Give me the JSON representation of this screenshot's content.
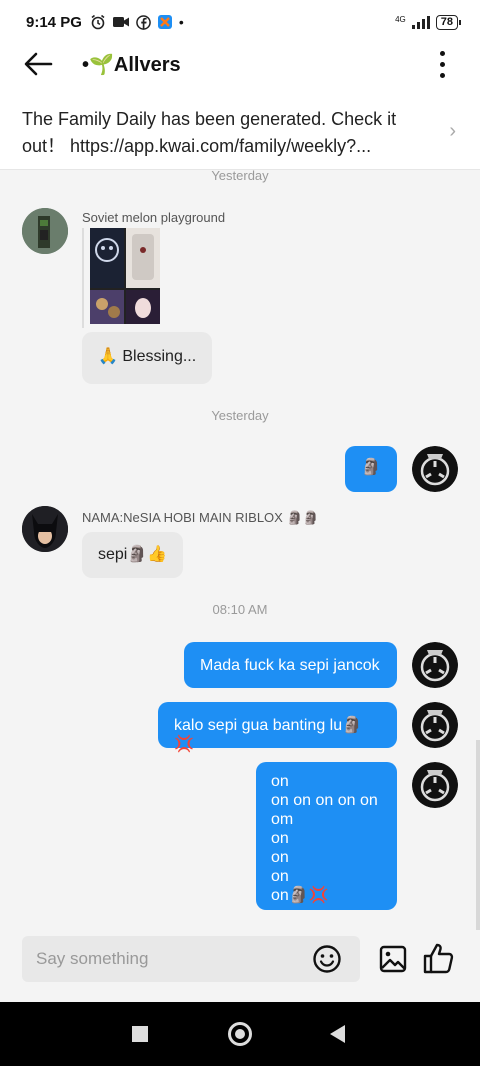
{
  "status_bar": {
    "time": "9:14 PG",
    "network": "4G",
    "battery": "78"
  },
  "header": {
    "title": "•🌱Allvers"
  },
  "notice": {
    "text": "The Family Daily has been generated. Check it out！ https://app.kwai.com/family/weekly?..."
  },
  "chat": {
    "top_timestamp": "Yesterday",
    "msg1": {
      "sender": "Soviet melon playground",
      "text": "🙏 Blessing..."
    },
    "timestamp2": "Yesterday",
    "msg2": {
      "text": "🗿"
    },
    "msg3": {
      "sender": "NAMA:NeSIA HOBI MAIN RIBLOX 🗿🗿",
      "text": "sepi🗿👍"
    },
    "timestamp3": "08:10 AM",
    "msg4": {
      "text": "Mada fuck ka sepi jancok"
    },
    "msg5": {
      "text": "kalo sepi gua banting lu🗿💢"
    },
    "msg6": {
      "lines": [
        "on",
        "on on on on on",
        "om",
        "on",
        "on",
        "on",
        "on🗿💢"
      ]
    }
  },
  "composer": {
    "placeholder": "Say something"
  },
  "colors": {
    "bubble_out": "#1e8ff4",
    "bubble_in": "#e9e9e9",
    "chat_bg": "#f4f4f4"
  },
  "icons": [
    "alarm-icon",
    "video-icon",
    "facebook-icon",
    "kwai-icon",
    "back-arrow-icon",
    "more-icon",
    "chevron-right-icon",
    "emoji-icon",
    "image-icon",
    "like-icon"
  ]
}
